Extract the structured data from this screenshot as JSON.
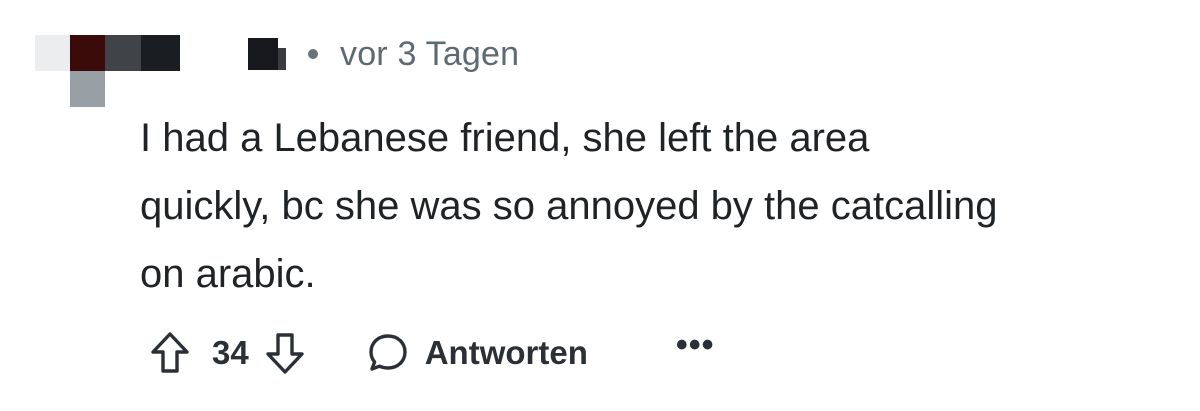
{
  "comment": {
    "timestamp": "vor 3 Tagen",
    "body_lines": [
      "I had a Lebanese friend, she left the area",
      "quickly, bc she was so annoyed by the catcalling",
      "on arabic."
    ],
    "actions": {
      "upvote_icon": "arrow-up-outline-icon",
      "vote_count": "34",
      "downvote_icon": "arrow-down-outline-icon",
      "reply_icon": "speech-bubble-icon",
      "reply_label": "Antworten",
      "more_label": "•••"
    }
  }
}
